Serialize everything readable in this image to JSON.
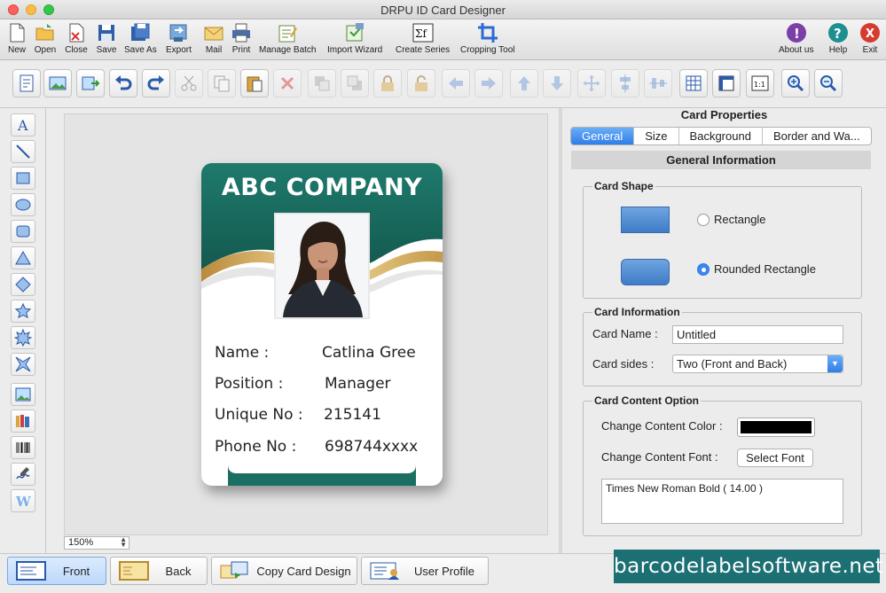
{
  "window": {
    "title": "DRPU ID Card Designer"
  },
  "toolbar": {
    "items": [
      {
        "label": "New",
        "icon": "new-document-icon"
      },
      {
        "label": "Open",
        "icon": "open-folder-icon"
      },
      {
        "label": "Close",
        "icon": "close-document-icon"
      },
      {
        "label": "Save",
        "icon": "save-disk-icon"
      },
      {
        "label": "Save As",
        "icon": "save-as-icon"
      },
      {
        "label": "Export",
        "icon": "export-icon"
      },
      {
        "label": "Mail",
        "icon": "mail-icon"
      },
      {
        "label": "Print",
        "icon": "printer-icon"
      },
      {
        "label": "Manage Batch",
        "icon": "manage-batch-icon"
      },
      {
        "label": "Import Wizard",
        "icon": "import-wizard-icon"
      },
      {
        "label": "Create Series",
        "icon": "create-series-icon"
      },
      {
        "label": "Cropping Tool",
        "icon": "crop-icon"
      }
    ],
    "right_items": [
      {
        "label": "About us",
        "icon": "info-icon",
        "color": "#7b3fa8"
      },
      {
        "label": "Help",
        "icon": "help-icon",
        "color": "#1d8f8f"
      },
      {
        "label": "Exit",
        "icon": "exit-icon",
        "color": "#d63b2f"
      }
    ]
  },
  "zoom": {
    "value": "150%"
  },
  "card": {
    "company": "ABC COMPANY",
    "fields": [
      {
        "label": "Name :",
        "value": "Catlina Gree"
      },
      {
        "label": "Position :",
        "value": "Manager"
      },
      {
        "label": "Unique No :",
        "value": "215141"
      },
      {
        "label": "Phone No :",
        "value": "698744xxxx"
      }
    ],
    "colors": {
      "header": "#1a6e62",
      "accent": "#c9a35c"
    }
  },
  "panel": {
    "title": "Card Properties",
    "tabs": [
      "General",
      "Size",
      "Background",
      "Border and Wa..."
    ],
    "active_tab": "General",
    "section_title": "General Information",
    "card_shape": {
      "label": "Card Shape",
      "options": [
        "Rectangle",
        "Rounded Rectangle"
      ],
      "selected": "Rounded Rectangle"
    },
    "card_information": {
      "label": "Card Information",
      "name_label": "Card Name :",
      "name_value": "Untitled",
      "sides_label": "Card sides :",
      "sides_value": "Two (Front and Back)"
    },
    "content_option": {
      "label": "Card Content Option",
      "color_label": "Change Content Color :",
      "color_value": "#000000",
      "font_label": "Change Content Font :",
      "font_button": "Select Font",
      "font_value": "Times New Roman Bold ( 14.00 )"
    }
  },
  "bottom": {
    "buttons": [
      {
        "label": "Front",
        "icon": "front-card-icon"
      },
      {
        "label": "Back",
        "icon": "back-card-icon"
      },
      {
        "label": "Copy Card Design",
        "icon": "copy-design-icon"
      },
      {
        "label": "User Profile",
        "icon": "user-profile-icon"
      }
    ],
    "active": "Front"
  },
  "watermark": "barcodelabelsoftware.net"
}
